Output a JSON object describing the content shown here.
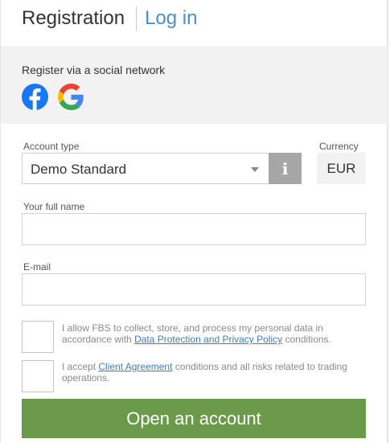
{
  "tabs": {
    "active": "Registration",
    "link": "Log in"
  },
  "social": {
    "title": "Register via a social network",
    "icons": [
      "facebook-icon",
      "google-icon"
    ]
  },
  "form": {
    "account_type_label": "Account type",
    "account_type_value": "Demo Standard",
    "currency_label": "Currency",
    "currency_value": "EUR",
    "info_icon": "i",
    "full_name_label": "Your full name",
    "full_name_value": "",
    "email_label": "E-mail",
    "email_value": ""
  },
  "consent": {
    "data_prefix": "I allow FBS to collect, store, and process my personal data in accordance with",
    "data_link": "Data Protection and Privacy Policy",
    "data_suffix": "conditions.",
    "agreement_prefix": "I accept",
    "agreement_link": "Client Agreement",
    "agreement_suffix": "conditions and all risks related to trading operations."
  },
  "submit_label": "Open an account",
  "colors": {
    "brand_blue": "#4a8fc6",
    "submit_green": "#6b9a4b",
    "panel_grey": "#f2f2f2"
  }
}
